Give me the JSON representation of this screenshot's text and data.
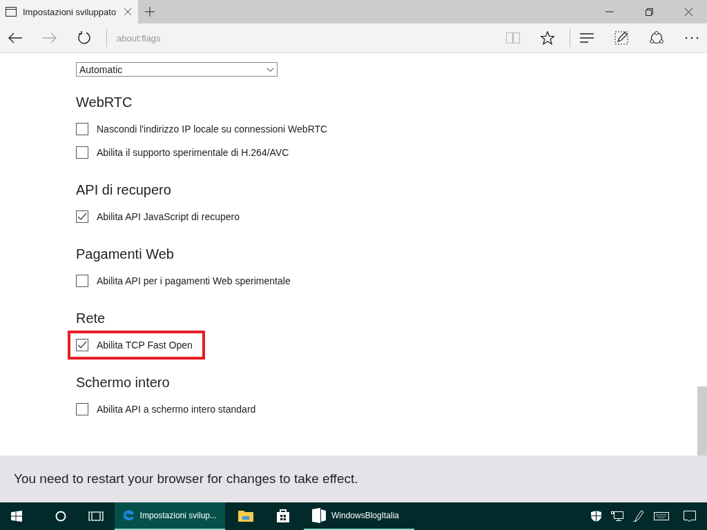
{
  "tab": {
    "title": "Impostazioni sviluppato",
    "selected": true
  },
  "address_bar": {
    "value": "about:flags"
  },
  "dropdown": {
    "value": "Automatic"
  },
  "sections": [
    {
      "heading": "WebRTC",
      "options": [
        {
          "label": "Nascondi l'indirizzo IP locale su connessioni WebRTC",
          "checked": false,
          "highlighted": false
        },
        {
          "label": "Abilita il supporto sperimentale di H.264/AVC",
          "checked": false,
          "highlighted": false
        }
      ]
    },
    {
      "heading": "API di recupero",
      "options": [
        {
          "label": "Abilita API JavaScript di recupero",
          "checked": true,
          "highlighted": false
        }
      ]
    },
    {
      "heading": "Pagamenti Web",
      "options": [
        {
          "label": "Abilita API per i pagamenti Web sperimentale",
          "checked": false,
          "highlighted": false
        }
      ]
    },
    {
      "heading": "Rete",
      "options": [
        {
          "label": "Abilita TCP Fast Open",
          "checked": true,
          "highlighted": true
        }
      ]
    },
    {
      "heading": "Schermo intero",
      "options": [
        {
          "label": "Abilita API a schermo intero standard",
          "checked": false,
          "highlighted": false
        }
      ]
    }
  ],
  "notification": "You need to restart your browser for changes to take effect.",
  "taskbar": {
    "apps": [
      {
        "kind": "edge",
        "label": "Impostazioni svilup...",
        "selected": true
      },
      {
        "kind": "folder",
        "selected": false
      },
      {
        "kind": "store",
        "selected": false
      },
      {
        "kind": "blog",
        "label": "WindowsBlogItalia",
        "selected": false
      }
    ]
  }
}
